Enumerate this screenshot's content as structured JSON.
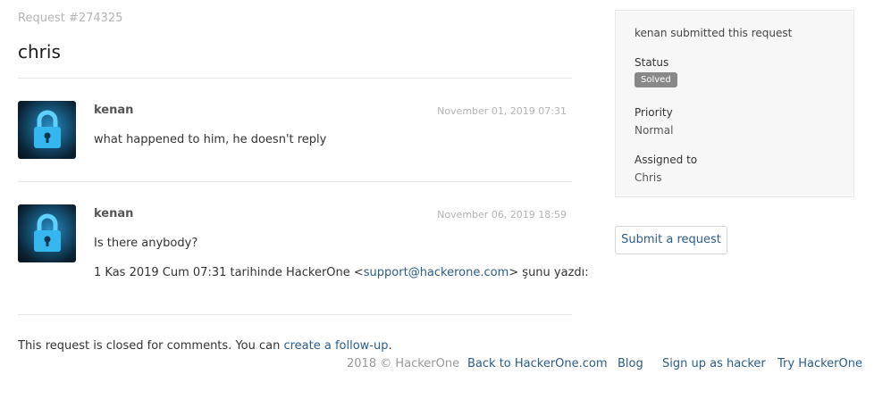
{
  "request": {
    "id_label": "Request #274325",
    "title": "chris"
  },
  "comments": [
    {
      "author": "kenan",
      "date": "November 01, 2019 07:31",
      "body": "what happened to him, he doesn't reply"
    },
    {
      "author": "kenan",
      "date": "November 06, 2019 18:59",
      "body": "Is there anybody?",
      "quote_prefix": "1 Kas 2019 Cum 07:31 tarihinde HackerOne <",
      "quote_email": "support@hackerone.com",
      "quote_suffix": "> şunu yazdı:"
    }
  ],
  "sidebar": {
    "submitted_text": "kenan submitted this request",
    "status_label": "Status",
    "status_value": "Solved",
    "priority_label": "Priority",
    "priority_value": "Normal",
    "assigned_label": "Assigned to",
    "assigned_value": "Chris",
    "submit_button": "Submit a request"
  },
  "closed_notice": {
    "text": "This request is closed for comments. You can ",
    "link": "create a follow-up",
    "end": "."
  },
  "footer": {
    "copyright": "2018 © HackerOne",
    "links": [
      "Back to HackerOne.com",
      "Blog",
      "Sign up as hacker",
      "Try HackerOne"
    ]
  },
  "colors": {
    "link": "#2b5c8a",
    "badge": "#888888",
    "sidebar_bg": "#f7f7f7"
  },
  "icons": {
    "avatar": "padlock-icon"
  }
}
